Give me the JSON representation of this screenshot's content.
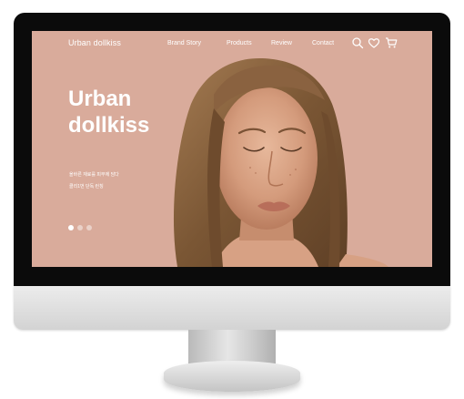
{
  "site": {
    "logo": "Urban dollkiss",
    "nav": [
      "Brand Story",
      "Products",
      "Review",
      "Contact"
    ],
    "icons": [
      "search-icon",
      "heart-icon",
      "cart-icon"
    ]
  },
  "hero": {
    "title_line1": "Urban",
    "title_line2": "dollkiss",
    "subtitle_line1": "올바른 재료를 피부에 담다",
    "subtitle_line2": "클리1번 단독 런칭",
    "slides": 3,
    "active_slide": 1
  },
  "colors": {
    "hero_background": "#d9ab9b",
    "text": "#ffffff",
    "bezel": "#0b0b0b"
  }
}
